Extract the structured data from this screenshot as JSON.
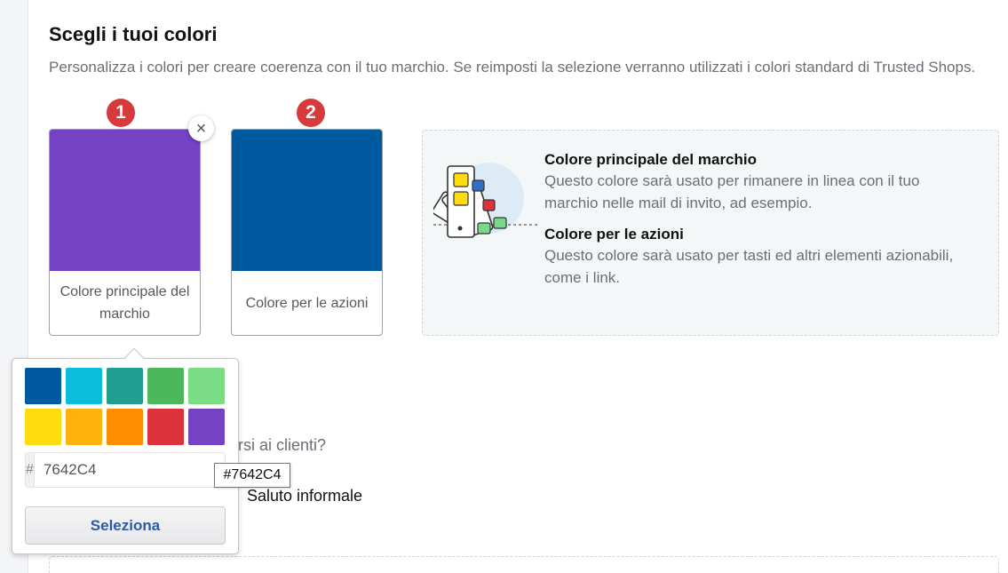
{
  "section": {
    "title": "Scegli i tuoi colori",
    "description": "Personalizza i colori per creare coerenza con il tuo marchio. Se reimposti la selezione verranno utilizzati i colori standard di Trusted Shops."
  },
  "markers": [
    "1",
    "2"
  ],
  "color_cards": [
    {
      "label": "Colore principale del marchio",
      "color": "#7642C4"
    },
    {
      "label": "Colore per le azioni",
      "color": "#005AA0"
    }
  ],
  "remove_button": {
    "icon": "close-icon",
    "glyph": "×"
  },
  "info": {
    "items": [
      {
        "title": "Colore principale del marchio",
        "text": "Questo colore sarà usato per rimanere in linea con il tuo marchio nelle mail di invito, ad esempio."
      },
      {
        "title": "Colore per le azioni",
        "text": "Questo colore sarà usato per tasti ed altri elementi azionabili, come i link."
      }
    ]
  },
  "background": {
    "question_fragment": "rsi ai clienti?",
    "option_label": "Saluto informale"
  },
  "color_picker": {
    "palette": [
      "#005AA0",
      "#0DBEDC",
      "#1F9E91",
      "#4CB85C",
      "#7ADD86",
      "#FFDC0F",
      "#FFB10D",
      "#FF8F00",
      "#DD3239",
      "#7642C4"
    ],
    "hex_prefix": "#",
    "hex_value": "7642C4",
    "select_label": "Seleziona",
    "tooltip": "#7642C4"
  }
}
